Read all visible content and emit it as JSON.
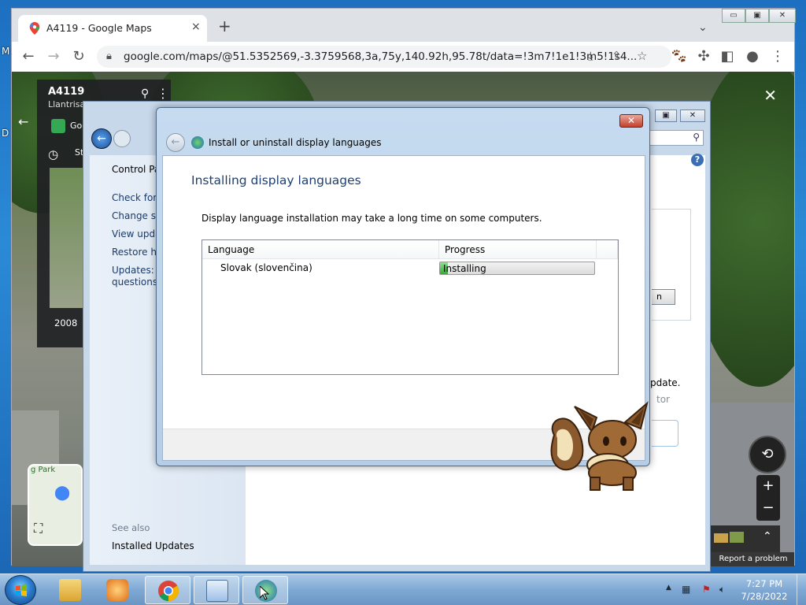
{
  "desktop": {
    "edge_letters": [
      "M",
      "D"
    ]
  },
  "chrome": {
    "tab_title": "A4119 - Google Maps",
    "tab_close": "×",
    "new_tab": "+",
    "url": "google.com/maps/@51.5352569,-3.3759568,3a,75y,140.92h,95.78t/data=!3m7!1e1!3m5!1s4...",
    "window_buttons": {
      "minimize": "▭",
      "maximize": "▣",
      "close": "✕"
    }
  },
  "streetview": {
    "place_title": "A4119",
    "place_subtitle": "Llantrisant",
    "google_label": "Goo",
    "history_label": "St",
    "year": "2008",
    "year_suffix": "(",
    "minimap_label": "g Park",
    "report_problem": "Report a problem"
  },
  "windows_update": {
    "sidebar": {
      "control_panel": "Control Pa",
      "links": [
        "Check for u",
        "Change set",
        "View updat",
        "Restore hic",
        "Updates: fr",
        "questions"
      ],
      "see_also": "See also",
      "installed_updates": "Installed Updates"
    },
    "fragments": {
      "button": "n",
      "update": "pdate.",
      "ator": "tor"
    }
  },
  "dialog": {
    "window_title": "Install or uninstall display languages",
    "heading": "Installing display languages",
    "description": "Display language installation may take a long time on some computers.",
    "columns": {
      "language": "Language",
      "progress": "Progress"
    },
    "rows": [
      {
        "language": "Slovak (slovenčina)",
        "status": "Installing",
        "progress_fraction": 0.05
      }
    ],
    "close_label": "✕"
  },
  "taskbar": {
    "clock_time": "7:27 PM",
    "clock_date": "7/28/2022",
    "tray_expand": "▲"
  },
  "colors": {
    "dialog_heading": "#1e3f6f",
    "progress_green": "#2fb02f",
    "close_red": "#c2402c"
  }
}
